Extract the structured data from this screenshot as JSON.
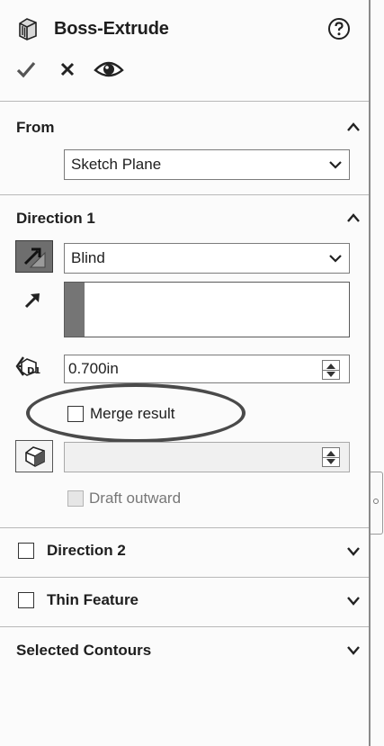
{
  "header": {
    "title": "Boss-Extrude",
    "icon": "extrude-feature-icon",
    "help_icon": "help-icon",
    "actions": [
      "ok-check-icon",
      "cancel-x-icon",
      "preview-eye-icon"
    ]
  },
  "from": {
    "title": "From",
    "start_condition": "Sketch Plane"
  },
  "direction1": {
    "title": "Direction 1",
    "end_condition": "Blind",
    "depth": "0.700in",
    "merge_result_label": "Merge result",
    "merge_result_checked": false,
    "draft_outward_label": "Draft outward",
    "draft_angle_value": ""
  },
  "direction2": {
    "title": "Direction 2",
    "checked": false
  },
  "thin_feature": {
    "title": "Thin Feature",
    "checked": false
  },
  "selected_contours": {
    "title": "Selected Contours"
  },
  "colors": {
    "highlight_ellipse": "#4a4a4a",
    "active_button": "#6e6e6e"
  }
}
